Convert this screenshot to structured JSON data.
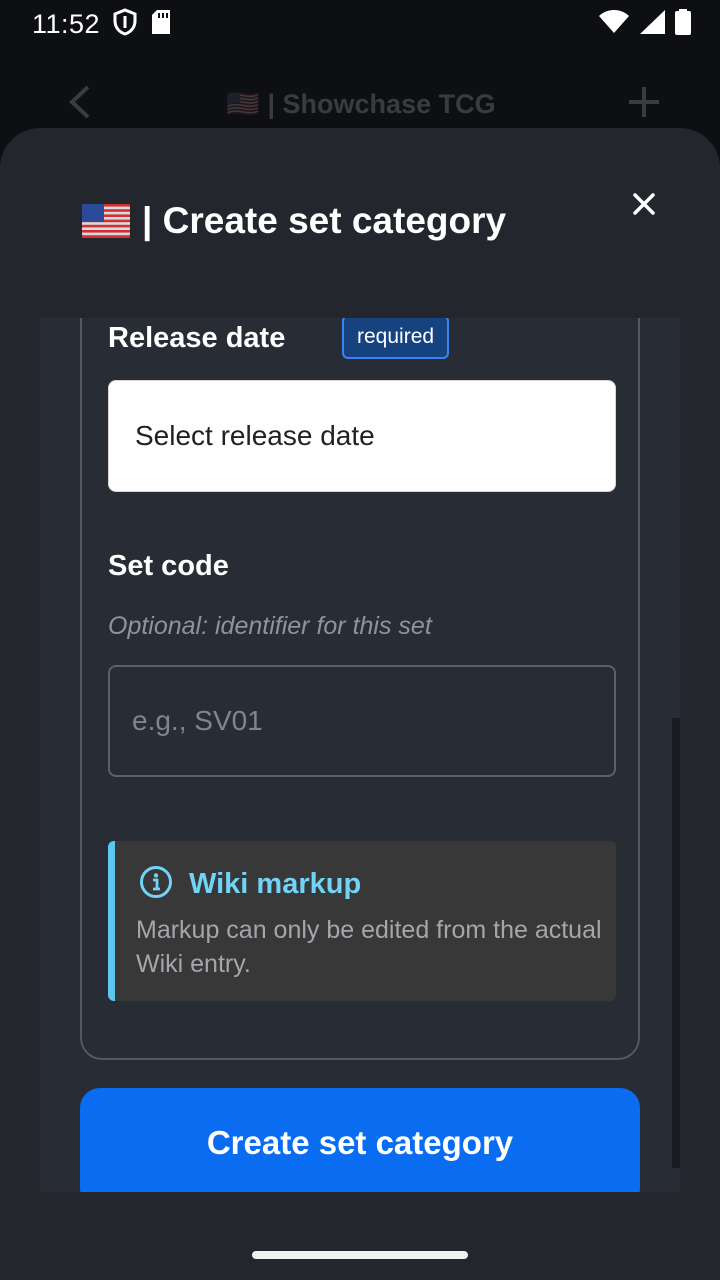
{
  "status_bar": {
    "time": "11:52",
    "icons": [
      "shield-icon",
      "sd-card-icon",
      "wifi-icon",
      "cell-signal-icon",
      "battery-icon"
    ]
  },
  "background_screen": {
    "title": "🇺🇸 | Showchase TCG",
    "icons": [
      "back-arrow-icon",
      "plus-icon"
    ]
  },
  "sheet": {
    "title": "| Create set category",
    "close_icon": "close-icon"
  },
  "form": {
    "release_date": {
      "label": "Release date",
      "badge": "required",
      "placeholder": "Select release date"
    },
    "set_code": {
      "label": "Set code",
      "helper": "Optional: identifier for this set",
      "placeholder": "e.g., SV01",
      "value": ""
    },
    "wiki_callout": {
      "icon": "info-icon",
      "title": "Wiki markup",
      "body": "Markup can only be edited from the actual Wiki entry."
    }
  },
  "submit_button": {
    "label": "Create set category"
  },
  "colors": {
    "sheet_background": "#23262d",
    "primary_button": "#0a6cf1",
    "callout_accent": "#5cc8f0",
    "badge_border": "#3b82f6"
  }
}
